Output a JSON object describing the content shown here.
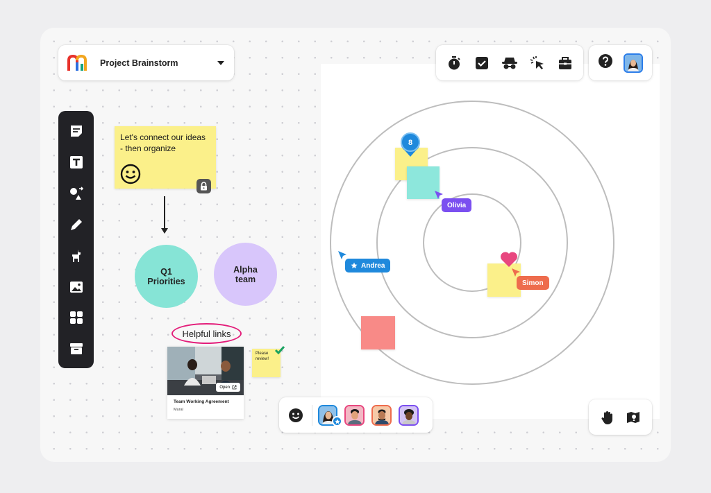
{
  "header": {
    "project_title": "Project Brainstorm",
    "dropdown_icon": "chevron-down-icon",
    "logo": "mural-logo"
  },
  "left_toolbar": {
    "items": [
      {
        "icon": "sticky-note-icon"
      },
      {
        "icon": "text-icon"
      },
      {
        "icon": "shapes-connectors-icon"
      },
      {
        "icon": "pencil-icon"
      },
      {
        "icon": "llama-icon"
      },
      {
        "icon": "image-icon"
      },
      {
        "icon": "templates-grid-icon"
      },
      {
        "icon": "archive-icon"
      }
    ]
  },
  "top_toolbar": {
    "items": [
      {
        "icon": "timer-icon"
      },
      {
        "icon": "checkbox-icon"
      },
      {
        "icon": "private-mode-icon"
      },
      {
        "icon": "cursor-click-icon"
      },
      {
        "icon": "toolbox-icon"
      }
    ],
    "help_icon": "help-icon",
    "user_avatar": "user-avatar"
  },
  "board": {
    "main_sticky": {
      "text": "Let's connect our ideas - then organize",
      "emoji": "smiley-icon",
      "color": "#fbf08a"
    },
    "circles": [
      {
        "label": "Q1 Priorities",
        "color": "#86e4d6"
      },
      {
        "label": "Alpha team",
        "color": "#d8c6fb"
      }
    ],
    "helpful_links": "Helpful links",
    "link_card": {
      "title": "Team Working Agreement",
      "subtitle": "Mural",
      "open_label": "Open"
    },
    "review_note": "Please review!",
    "pin_count": "8",
    "collaborators": [
      {
        "name": "Olivia",
        "color": "#7b4ff0"
      },
      {
        "name": "Andrea",
        "color": "#1f89dc"
      },
      {
        "name": "Simon",
        "color": "#ee6c4d"
      }
    ]
  },
  "bottom_bar": {
    "reaction_icon": "smiley-icon",
    "avatars": [
      "participant-1",
      "participant-2",
      "participant-3",
      "participant-4"
    ]
  },
  "bottom_right": {
    "items": [
      {
        "icon": "hand-icon"
      },
      {
        "icon": "map-icon"
      }
    ]
  },
  "colors": {
    "accent_pink": "#e31c79",
    "dark_toolbar": "#222226",
    "sticky_yellow": "#fbf08a",
    "teal": "#86e4d6",
    "salmon": "#f88a87"
  }
}
